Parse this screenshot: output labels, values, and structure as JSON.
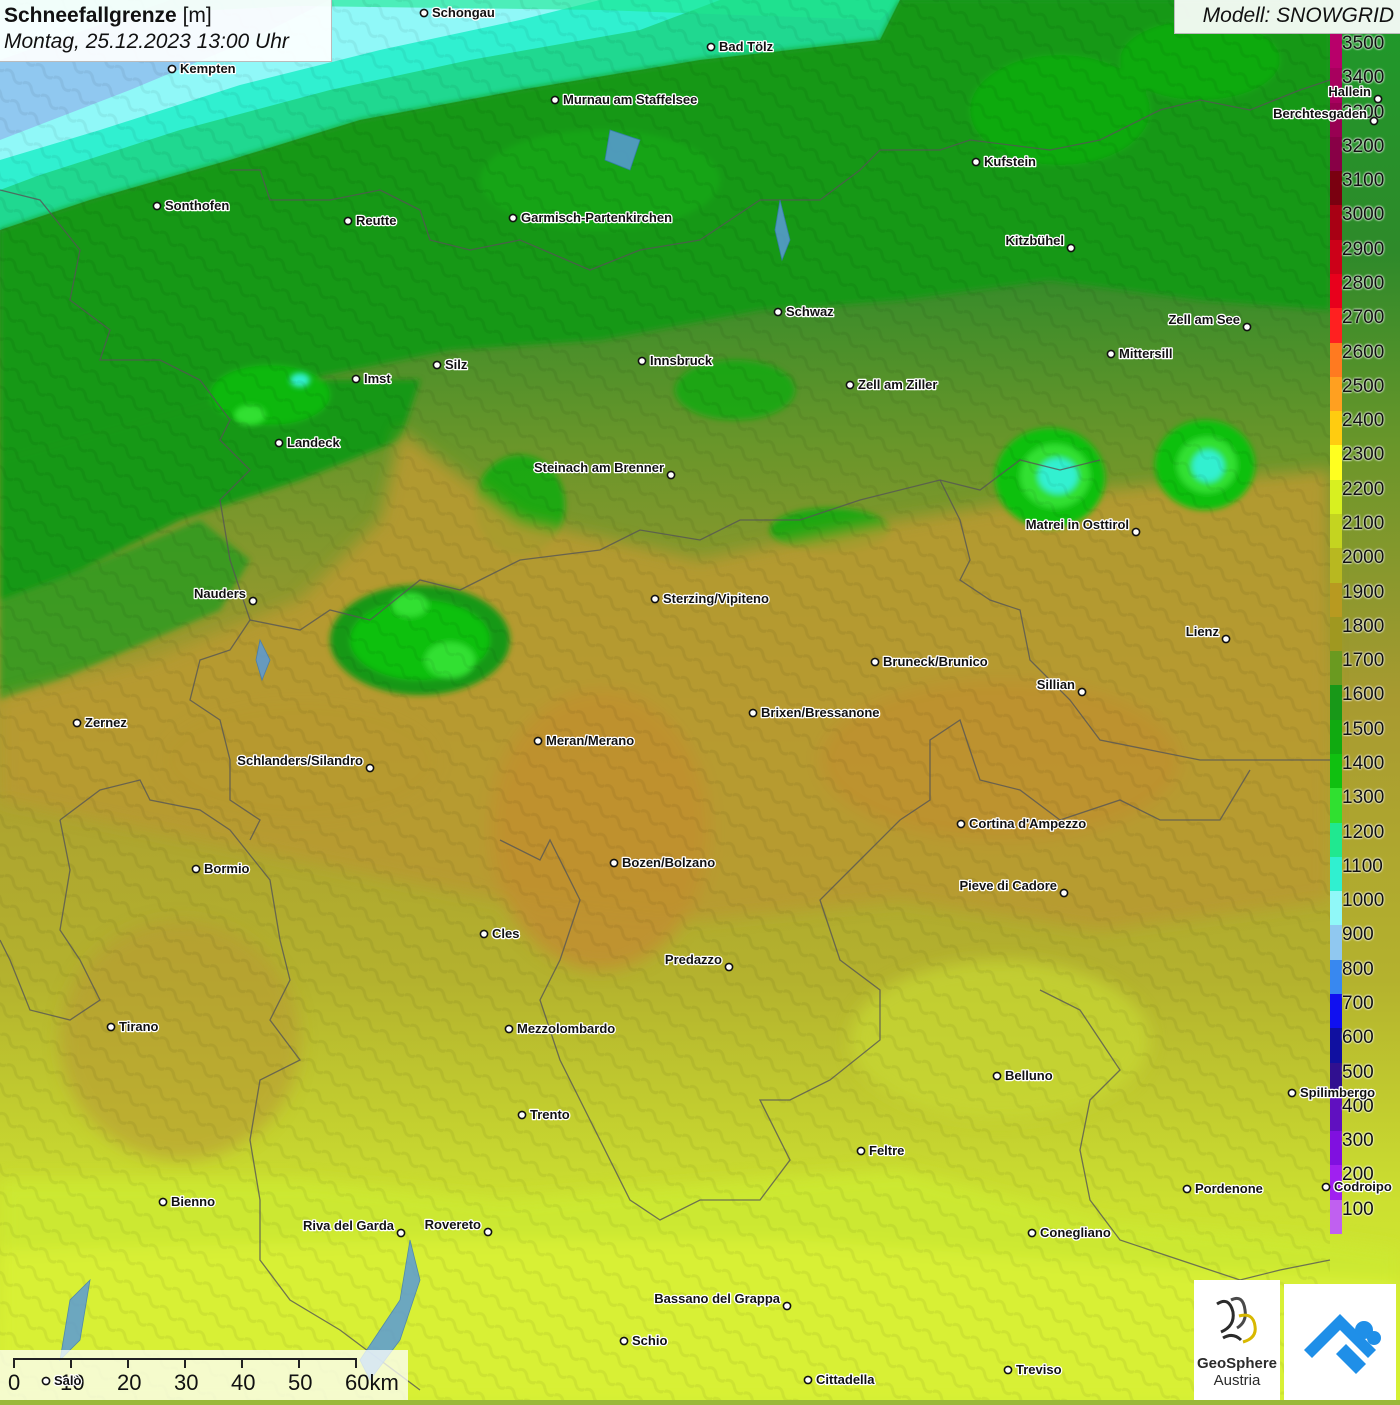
{
  "title": {
    "main": "Schneefallgrenze",
    "unit": "[m]",
    "datetime": "Montag, 25.12.2023 13:00 Uhr"
  },
  "model": {
    "label": "Modell: SNOWGRID"
  },
  "legend": {
    "levels": [
      {
        "value": "3500",
        "color": "#b8006a"
      },
      {
        "value": "3400",
        "color": "#a8005e"
      },
      {
        "value": "3300",
        "color": "#980052"
      },
      {
        "value": "3200",
        "color": "#880046"
      },
      {
        "value": "3100",
        "color": "#7a0010"
      },
      {
        "value": "3000",
        "color": "#a80014"
      },
      {
        "value": "2900",
        "color": "#cc0018"
      },
      {
        "value": "2800",
        "color": "#e8001c"
      },
      {
        "value": "2700",
        "color": "#ff2020"
      },
      {
        "value": "2600",
        "color": "#ff7a20"
      },
      {
        "value": "2500",
        "color": "#ffa020"
      },
      {
        "value": "2400",
        "color": "#ffcc10"
      },
      {
        "value": "2300",
        "color": "#ffff20"
      },
      {
        "value": "2200",
        "color": "#d8f020"
      },
      {
        "value": "2100",
        "color": "#c4d420"
      },
      {
        "value": "2000",
        "color": "#b8b820"
      },
      {
        "value": "1900",
        "color": "#b89a20"
      },
      {
        "value": "1800",
        "color": "#a09820"
      },
      {
        "value": "1700",
        "color": "#6a9a20"
      },
      {
        "value": "1600",
        "color": "#189818"
      },
      {
        "value": "1500",
        "color": "#10aa10"
      },
      {
        "value": "1400",
        "color": "#10c010"
      },
      {
        "value": "1300",
        "color": "#30e030"
      },
      {
        "value": "1200",
        "color": "#20e890"
      },
      {
        "value": "1100",
        "color": "#30f0d0"
      },
      {
        "value": "1000",
        "color": "#90f8f8"
      },
      {
        "value": "900",
        "color": "#90c8f0"
      },
      {
        "value": "800",
        "color": "#3888f0"
      },
      {
        "value": "700",
        "color": "#1010f0"
      },
      {
        "value": "600",
        "color": "#1010a0"
      },
      {
        "value": "500",
        "color": "#301090"
      },
      {
        "value": "400",
        "color": "#6010c0"
      },
      {
        "value": "300",
        "color": "#8010e0"
      },
      {
        "value": "200",
        "color": "#a020f0"
      },
      {
        "value": "100",
        "color": "#c060f0"
      }
    ]
  },
  "cities": [
    {
      "name": "Schongau"
    },
    {
      "name": "Bad Tölz"
    },
    {
      "name": "Kempten"
    },
    {
      "name": "Murnau am Staffelsee"
    },
    {
      "name": "Hallein"
    },
    {
      "name": "Berchtesgaden"
    },
    {
      "name": "Kufstein"
    },
    {
      "name": "Sonthofen"
    },
    {
      "name": "Reutte"
    },
    {
      "name": "Garmisch-Partenkirchen"
    },
    {
      "name": "Kitzbühel"
    },
    {
      "name": "Schwaz"
    },
    {
      "name": "Zell am See"
    },
    {
      "name": "Mittersill"
    },
    {
      "name": "Innsbruck"
    },
    {
      "name": "Imst"
    },
    {
      "name": "Silz"
    },
    {
      "name": "Zell am Ziller"
    },
    {
      "name": "Landeck"
    },
    {
      "name": "Steinach am Brenner"
    },
    {
      "name": "Matrei in Osttirol"
    },
    {
      "name": "Nauders"
    },
    {
      "name": "Sterzing/Vipiteno"
    },
    {
      "name": "Lienz"
    },
    {
      "name": "Bruneck/Brunico"
    },
    {
      "name": "Sillian"
    },
    {
      "name": "Brixen/Bressanone"
    },
    {
      "name": "Zernez"
    },
    {
      "name": "Meran/Merano"
    },
    {
      "name": "Schlanders/Silandro"
    },
    {
      "name": "Cortina d'Ampezzo"
    },
    {
      "name": "Bozen/Bolzano"
    },
    {
      "name": "Bormio"
    },
    {
      "name": "Pieve di Cadore"
    },
    {
      "name": "Cles"
    },
    {
      "name": "Predazzo"
    },
    {
      "name": "Tirano"
    },
    {
      "name": "Mezzolombardo"
    },
    {
      "name": "Belluno"
    },
    {
      "name": "Spilimbergo"
    },
    {
      "name": "Trento"
    },
    {
      "name": "Feltre"
    },
    {
      "name": "Pordenone"
    },
    {
      "name": "Codroipo"
    },
    {
      "name": "Bienno"
    },
    {
      "name": "Riva del Garda"
    },
    {
      "name": "Rovereto"
    },
    {
      "name": "Conegliano"
    },
    {
      "name": "Bassano del Grappa"
    },
    {
      "name": "Schio"
    },
    {
      "name": "Treviso"
    },
    {
      "name": "Cittadella"
    },
    {
      "name": "Salò"
    }
  ],
  "scale": {
    "ticks": [
      "0",
      "10",
      "20",
      "30",
      "40",
      "50",
      "60km"
    ]
  },
  "logos": {
    "geosphere_line1": "GeoSphere",
    "geosphere_line2": "Austria"
  }
}
